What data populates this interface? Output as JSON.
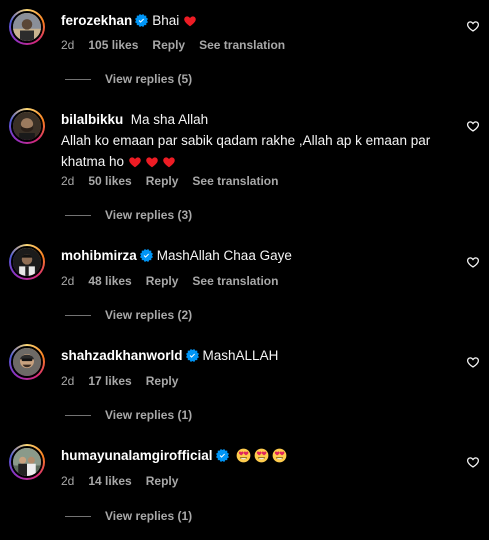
{
  "comments": [
    {
      "username": "ferozekhan",
      "verified": true,
      "text": "Bhai",
      "text_line2": "",
      "time": "2d",
      "likes": "105 likes",
      "reply": "Reply",
      "translation": "See translation",
      "view_replies": "View replies (5)",
      "trailing": "red-heart-emoji"
    },
    {
      "username": "bilalbikku",
      "verified": false,
      "text": "Ma sha Allah",
      "text_line2": "Allah ko emaan par sabik qadam rakhe ,Allah ap k emaan par khatma ho",
      "time": "2d",
      "likes": "50 likes",
      "reply": "Reply",
      "translation": "See translation",
      "view_replies": "View replies (3)",
      "trailing": "red-heart-emoji x3"
    },
    {
      "username": "mohibmirza",
      "verified": true,
      "text": "MashAllah Chaa Gaye",
      "time": "2d",
      "likes": "48 likes",
      "reply": "Reply",
      "translation": "See translation",
      "view_replies": "View replies (2)"
    },
    {
      "username": "shahzadkhanworld",
      "verified": true,
      "text": "MashALLAH",
      "time": "2d",
      "likes": "17 likes",
      "reply": "Reply",
      "view_replies": "View replies (1)"
    },
    {
      "username": "humayunalamgirofficial",
      "verified": true,
      "text": "",
      "time": "2d",
      "likes": "14 likes",
      "reply": "Reply",
      "view_replies": "View replies (1)",
      "trailing": "heart-eyes-emoji x3"
    }
  ],
  "colors": {
    "background": "#000000",
    "text": "#f5f5f5",
    "muted": "#a8a8a8",
    "verified": "#0095f6",
    "heart_emoji": "#ed1c24"
  },
  "icons": {
    "verified": "verified-badge-icon",
    "like": "heart-outline-icon",
    "emoji_heart": "red-heart-emoji",
    "emoji_heart_eyes": "heart-eyes-emoji"
  }
}
